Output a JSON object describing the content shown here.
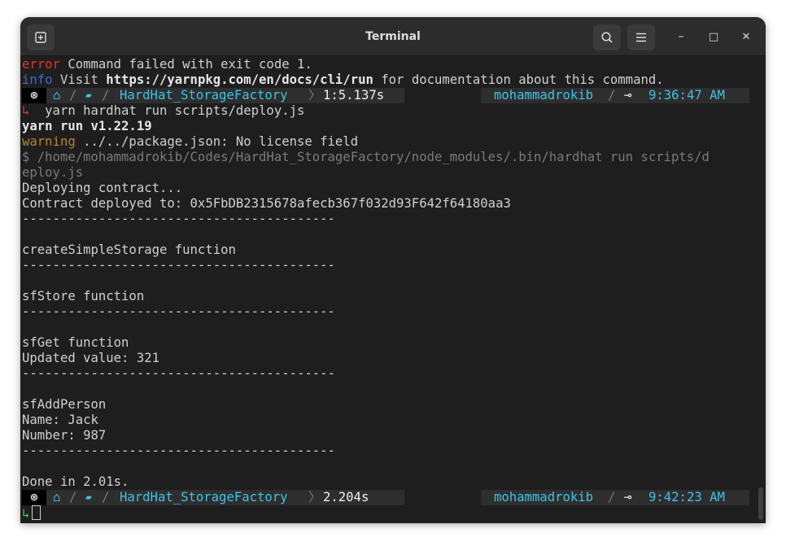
{
  "window": {
    "title": "Terminal"
  },
  "titlebar": {
    "new_tab_icon": "new-tab-icon",
    "search_icon": "search-icon",
    "menu_icon": "hamburger-menu-icon",
    "minimize_glyph": "–",
    "maximize_glyph": "□",
    "close_glyph": "✕"
  },
  "output": {
    "line1_tag": "error",
    "line1_text": " Command failed with exit code 1.",
    "line2_tag": "info",
    "line2_pre": " Visit ",
    "line2_url": "https://yarnpkg.com/en/docs/cli/run",
    "line2_post": " for documentation about this command.",
    "cmd_arrow": "↳",
    "command": "  yarn hardhat run scripts/deploy.js",
    "yarn_version": "yarn run v1.22.19",
    "warn_tag": "warning",
    "warn_text": " ../../package.json: No license field",
    "exec_line1": "$ /home/mohammadrokib/Codes/HardHat_StorageFactory/node_modules/.bin/hardhat run scripts/d",
    "exec_line2": "eploy.js",
    "deploying": "Deploying contract...",
    "deployed": "Contract deployed to: 0x5FbDB2315678afecb367f032d93F642f64180aa3",
    "separator": "-----------------------------------------",
    "create_fn": "createSimpleStorage function",
    "sfstore_fn": "sfStore function",
    "sfget_fn": "sfGet function",
    "updated_value": "Updated value: 321",
    "sfadd_fn": "sfAddPerson",
    "name_line": "Name: Jack",
    "number_line": "Number: 987",
    "done": "Done in 2.01s."
  },
  "prompts": [
    {
      "os_glyph": "⊛",
      "home_glyph": "⌂",
      "folder_glyph": "▰",
      "dir": "HardHat_StorageFactory",
      "duration": "1:5.137s",
      "user": "mohammadrokib",
      "clock_glyph": "⊸",
      "time": "9:36:47 AM"
    },
    {
      "os_glyph": "⊛",
      "home_glyph": "⌂",
      "folder_glyph": "▰",
      "dir": "HardHat_StorageFactory",
      "duration": "2.204s",
      "user": "mohammadrokib",
      "clock_glyph": "⊸",
      "time": "9:42:23 AM"
    }
  ],
  "input_arrow": "↳"
}
